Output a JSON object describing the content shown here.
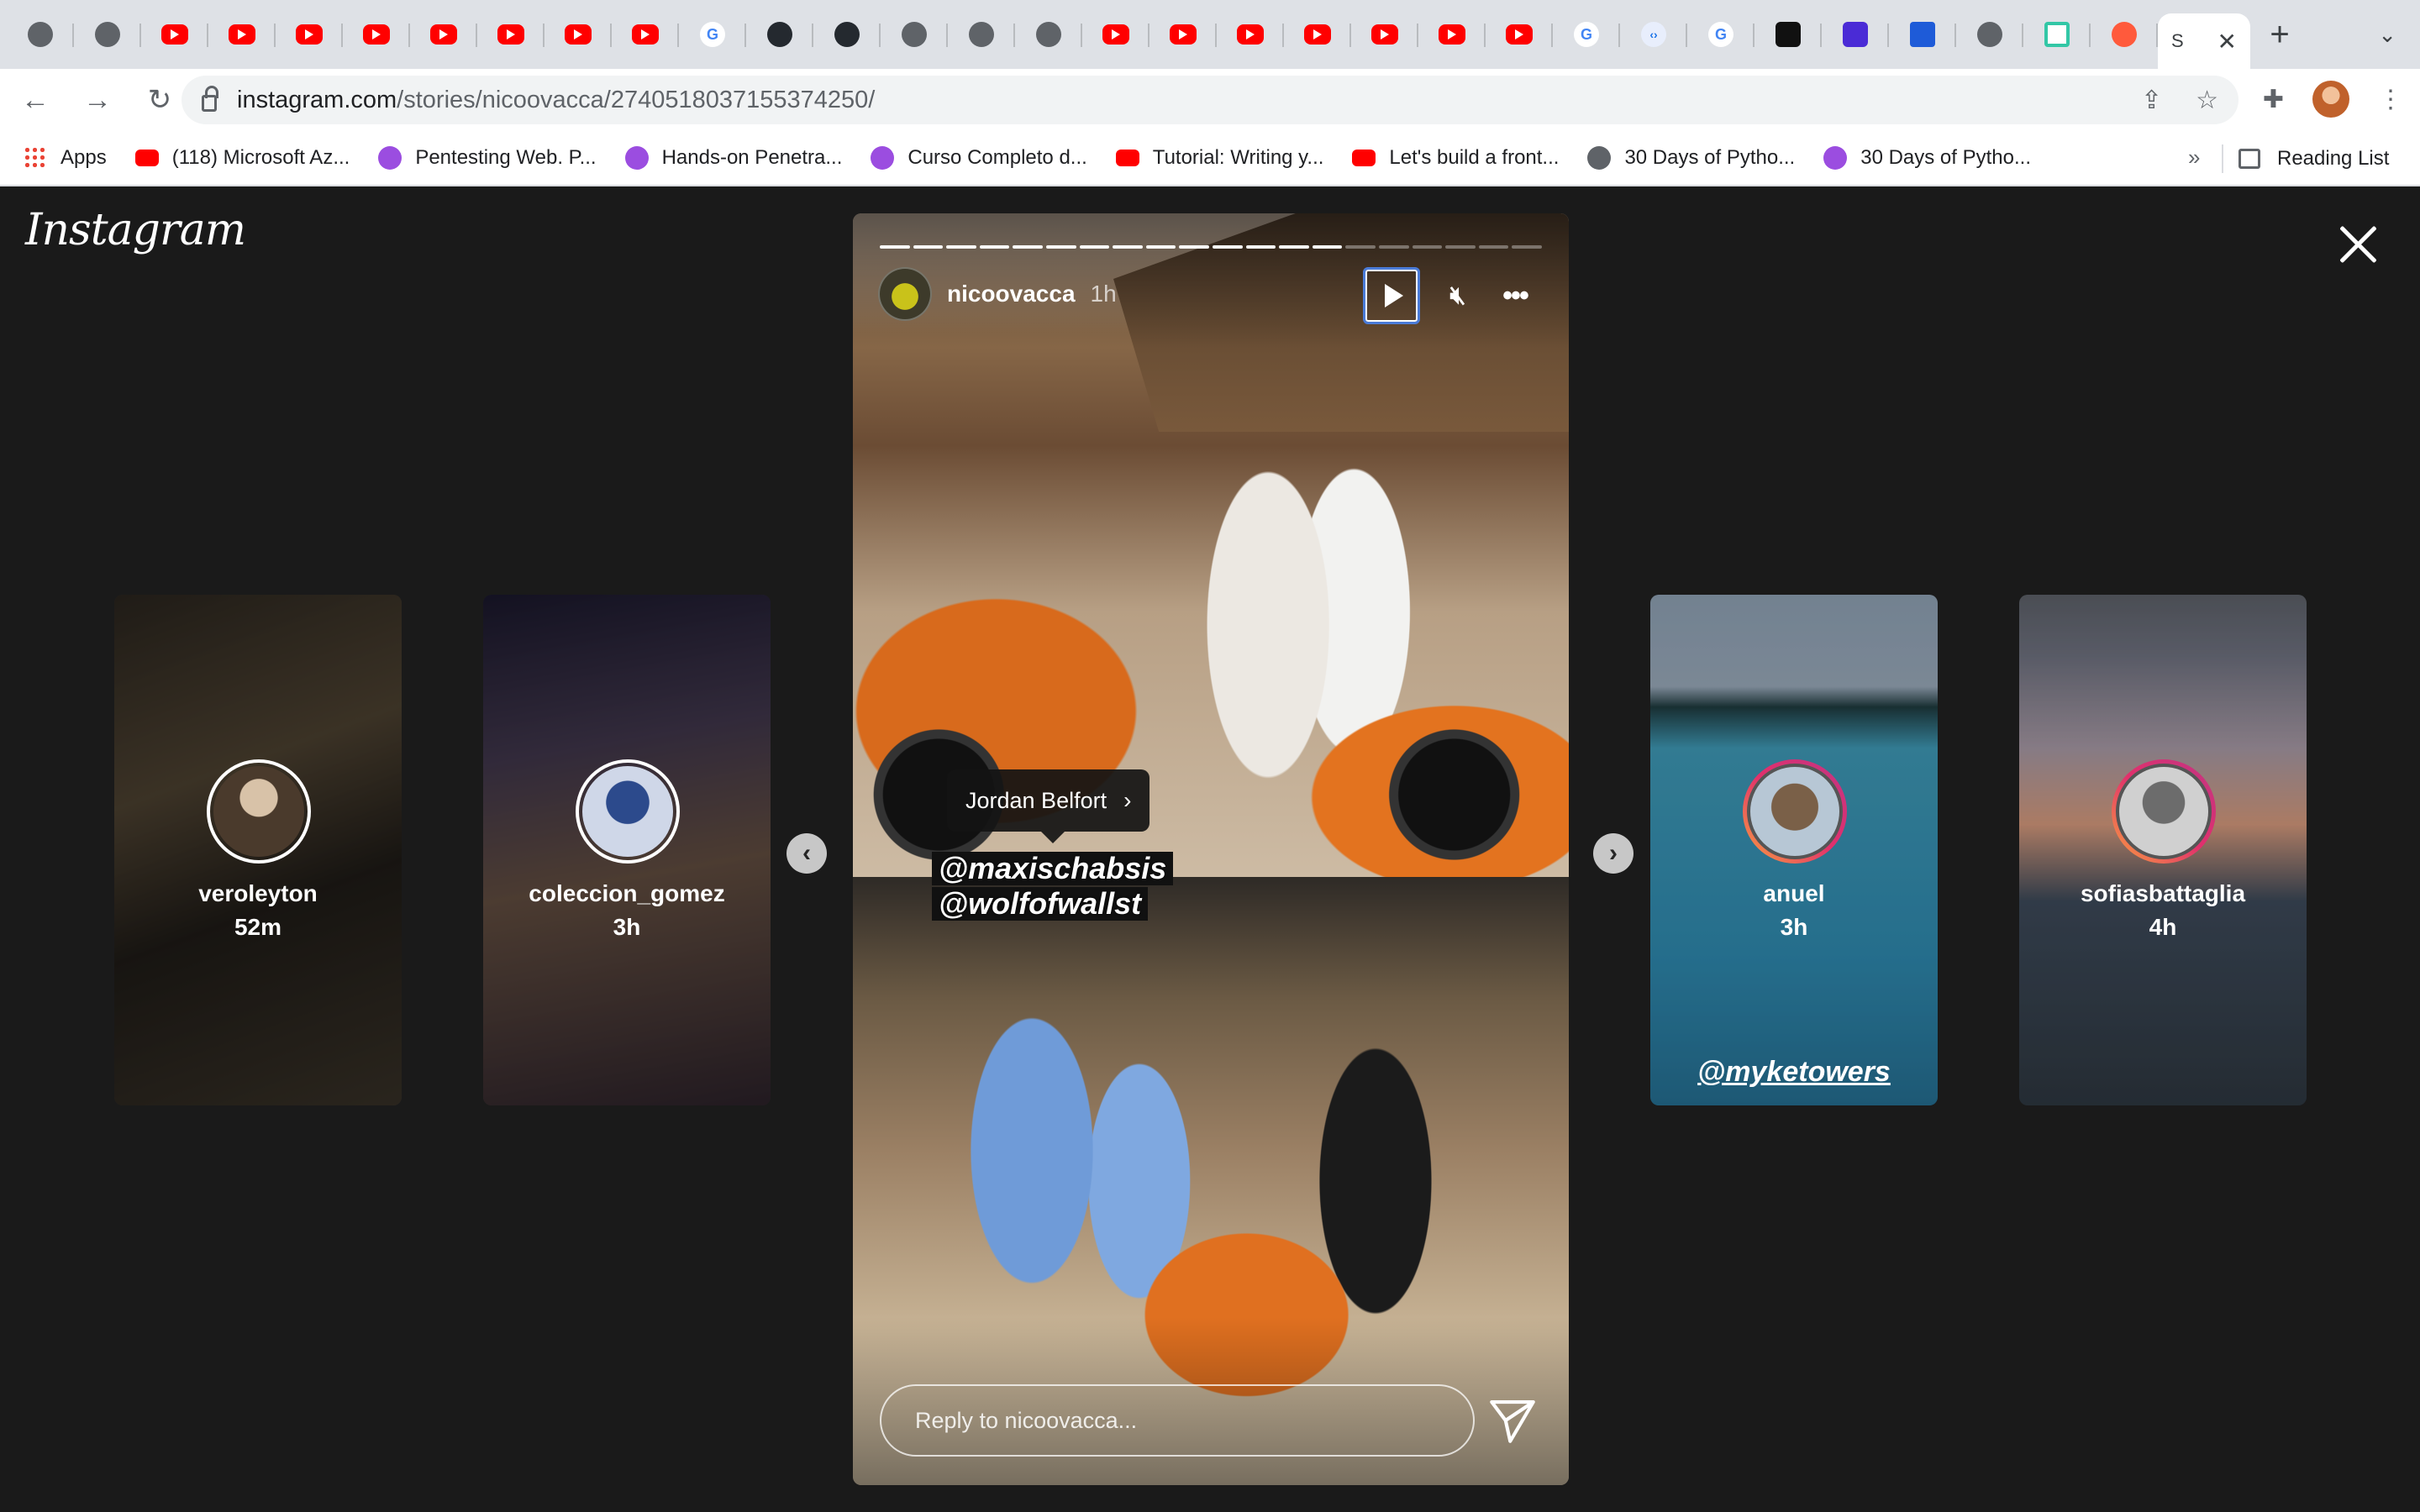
{
  "browser": {
    "tabs": [
      {
        "icon": "globe-icon",
        "kind": "globe"
      },
      {
        "icon": "globe-icon",
        "kind": "globe"
      },
      {
        "icon": "youtube-icon",
        "kind": "yt"
      },
      {
        "icon": "youtube-icon",
        "kind": "yt"
      },
      {
        "icon": "youtube-icon",
        "kind": "yt"
      },
      {
        "icon": "youtube-icon",
        "kind": "yt"
      },
      {
        "icon": "youtube-icon",
        "kind": "yt"
      },
      {
        "icon": "youtube-icon",
        "kind": "yt"
      },
      {
        "icon": "youtube-icon",
        "kind": "yt"
      },
      {
        "icon": "youtube-icon",
        "kind": "yt"
      },
      {
        "icon": "google-icon",
        "kind": "google"
      },
      {
        "icon": "github-icon",
        "kind": "gh"
      },
      {
        "icon": "github-icon",
        "kind": "gh"
      },
      {
        "icon": "globe-icon",
        "kind": "globe"
      },
      {
        "icon": "globe-icon",
        "kind": "globe"
      },
      {
        "icon": "globe-icon",
        "kind": "globe"
      },
      {
        "icon": "youtube-icon",
        "kind": "yt"
      },
      {
        "icon": "youtube-icon",
        "kind": "yt"
      },
      {
        "icon": "youtube-icon",
        "kind": "yt"
      },
      {
        "icon": "youtube-icon",
        "kind": "yt"
      },
      {
        "icon": "youtube-icon",
        "kind": "yt"
      },
      {
        "icon": "youtube-icon",
        "kind": "yt"
      },
      {
        "icon": "youtube-icon",
        "kind": "yt"
      },
      {
        "icon": "google-icon",
        "kind": "google"
      },
      {
        "icon": "code-icon",
        "kind": "code"
      },
      {
        "icon": "google-icon",
        "kind": "google"
      },
      {
        "icon": "app-icon",
        "kind": "dark"
      },
      {
        "icon": "yahoo-icon",
        "kind": "purple"
      },
      {
        "icon": "app-icon",
        "kind": "blue"
      },
      {
        "icon": "globe-icon",
        "kind": "globe"
      },
      {
        "icon": "app-icon",
        "kind": "teal"
      },
      {
        "icon": "app-icon",
        "kind": "orange"
      }
    ],
    "active_tab": {
      "title": "S",
      "close": "✕"
    },
    "new_tab": "+",
    "tab_menu": "⌄",
    "url_host": "instagram.com",
    "url_path": "/stories/nicoovacca/2740518037155374250/",
    "bookmarks": [
      {
        "label": "Apps",
        "icon": "apps-icon",
        "kind": "apps"
      },
      {
        "label": "(118) Microsoft Az...",
        "icon": "youtube-icon",
        "kind": "ytb"
      },
      {
        "label": "Pentesting Web. P...",
        "icon": "ine-icon",
        "kind": "ine"
      },
      {
        "label": "Hands-on Penetra...",
        "icon": "ine-icon",
        "kind": "ine"
      },
      {
        "label": "Curso Completo d...",
        "icon": "ine-icon",
        "kind": "ine"
      },
      {
        "label": "Tutorial: Writing y...",
        "icon": "youtube-icon",
        "kind": "ytb"
      },
      {
        "label": "Let's build a front...",
        "icon": "youtube-icon",
        "kind": "ytb"
      },
      {
        "label": "30 Days of Pytho...",
        "icon": "globe-icon",
        "kind": "glb"
      },
      {
        "label": "30 Days of Pytho...",
        "icon": "ine-icon",
        "kind": "ine"
      }
    ],
    "bookmarks_more": "»",
    "reading_list": "Reading List"
  },
  "instagram": {
    "logo": "Instagram",
    "story": {
      "username": "nicoovacca",
      "time": "1h",
      "progress_total": 20,
      "progress_done": 14,
      "mention_tag": "Jordan Belfort",
      "sticker_lines": [
        "@maxischabsis",
        "@wolfofwallst"
      ],
      "reply_placeholder": "Reply to nicoovacca..."
    },
    "previews": [
      {
        "username": "veroleyton",
        "time": "52m",
        "tag": ""
      },
      {
        "username": "coleccion_gomez",
        "time": "3h",
        "tag": ""
      },
      {
        "username": "anuel",
        "time": "3h",
        "tag": "@myketowers"
      },
      {
        "username": "sofiasbattaglia",
        "time": "4h",
        "tag": ""
      }
    ]
  },
  "colors": {
    "background": "#1a1a1a",
    "story_ring_start": "#f9a03f",
    "story_ring_end": "#c13584",
    "focus_outline": "#4a7bd8"
  }
}
